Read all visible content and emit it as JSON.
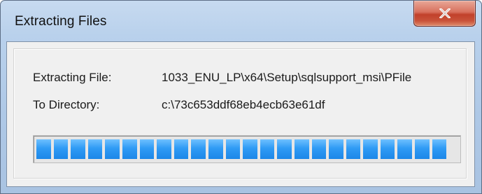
{
  "window": {
    "title": "Extracting Files",
    "close_icon": "close-icon"
  },
  "details": {
    "file_label": "Extracting File:",
    "file_value": "1033_ENU_LP\\x64\\Setup\\sqlsupport_msi\\PFile",
    "dir_label": "To Directory:",
    "dir_value": "c:\\73c653ddf68eb4ecb63e61df"
  },
  "progress": {
    "percent": 100,
    "color": "#2f9bf5"
  }
}
